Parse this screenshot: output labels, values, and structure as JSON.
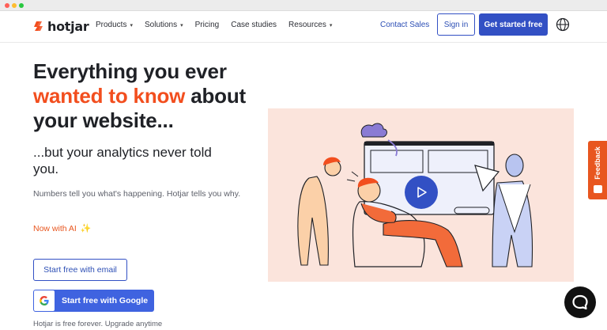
{
  "brand": {
    "name": "hotjar",
    "accent": "#f24e1e",
    "primary": "#3250c4"
  },
  "nav": {
    "menu": [
      {
        "label": "Products",
        "has_caret": true
      },
      {
        "label": "Solutions",
        "has_caret": true
      },
      {
        "label": "Pricing",
        "has_caret": false
      },
      {
        "label": "Case studies",
        "has_caret": false
      },
      {
        "label": "Resources",
        "has_caret": true
      }
    ],
    "contact_label": "Contact Sales",
    "signin_label": "Sign in",
    "cta_label": "Get started free",
    "globe_icon": "globe-icon"
  },
  "hero": {
    "headline_line1": "Everything you ever",
    "headline_accent": "wanted to know",
    "headline_line2_rest": " about",
    "headline_line3": "your website...",
    "subhead": "...but your analytics never told you.",
    "body": "Numbers tell you what's happening. Hotjar tells you why.",
    "ai_note": "Now with AI",
    "ai_icon": "sparkle-icon",
    "email_button": "Start free with email",
    "google_button": "Start free with Google",
    "fineprint": "Hotjar is free forever. Upgrade anytime"
  },
  "illustration": {
    "play_icon": "play-icon"
  },
  "feedback_tab": {
    "label": "Feedback"
  },
  "chat": {
    "icon": "chat-bubble-icon"
  }
}
